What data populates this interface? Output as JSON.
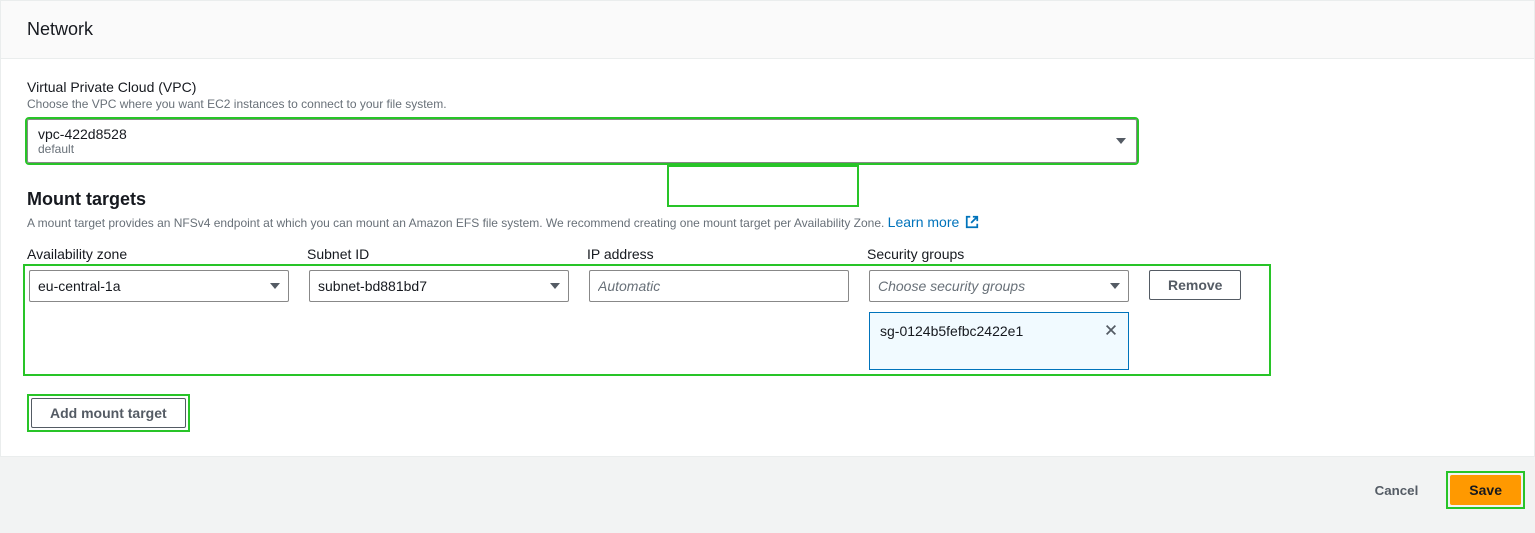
{
  "card": {
    "title": "Network"
  },
  "vpc": {
    "label": "Virtual Private Cloud (VPC)",
    "help": "Choose the VPC where you want EC2 instances to connect to your file system.",
    "value": "vpc-422d8528",
    "subvalue": "default"
  },
  "mount_targets": {
    "heading": "Mount targets",
    "description": "A mount target provides an NFSv4 endpoint at which you can mount an Amazon EFS file system. We recommend creating one mount target per Availability Zone. ",
    "learn_more": "Learn more ",
    "columns": {
      "az": "Availability zone",
      "subnet": "Subnet ID",
      "ip": "IP address",
      "sg": "Security groups"
    },
    "row": {
      "az": "eu-central-1a",
      "subnet": "subnet-bd881bd7",
      "ip_placeholder": "Automatic",
      "sg_placeholder": "Choose security groups",
      "sg_tag": "sg-0124b5fefbc2422e1",
      "remove": "Remove"
    },
    "add_button": "Add mount target"
  },
  "footer": {
    "cancel": "Cancel",
    "save": "Save"
  }
}
